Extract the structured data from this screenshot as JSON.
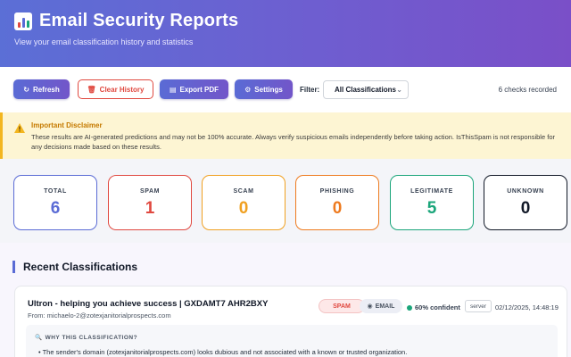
{
  "header": {
    "title": "Email Security Reports",
    "subtitle": "View your email classification history and statistics"
  },
  "toolbar": {
    "refresh_label": "Refresh",
    "clear_label": "Clear History",
    "export_label": "Export PDF",
    "settings_label": "Settings",
    "filter_label": "Filter:",
    "filter_selected": "All Classifications",
    "checks_recorded": "6 checks recorded"
  },
  "disclaimer": {
    "title": "Important Disclaimer",
    "text": "These results are AI-generated predictions and may not be 100% accurate. Always verify suspicious emails independently before taking action. IsThisSpam is not responsible for any decisions made based on these results."
  },
  "stats": [
    {
      "label": "TOTAL",
      "value": "6",
      "color": "#5a6bd5"
    },
    {
      "label": "SPAM",
      "value": "1",
      "color": "#e0483f"
    },
    {
      "label": "SCAM",
      "value": "0",
      "color": "#f0a020"
    },
    {
      "label": "PHISHING",
      "value": "0",
      "color": "#ee7a1e"
    },
    {
      "label": "LEGITIMATE",
      "value": "5",
      "color": "#1aa57a"
    },
    {
      "label": "UNKNOWN",
      "value": "0",
      "color": "#111827"
    }
  ],
  "recent": {
    "title": "Recent Classifications",
    "items": [
      {
        "subject": "Ultron - helping you achieve success | GXDAMT7 AHR2BXY",
        "from": "From: michaelo-2@zotexjanitorialprospects.com",
        "classification": "SPAM",
        "type": "EMAIL",
        "confidence": "60% confident",
        "source": "server",
        "timestamp": "02/12/2025, 14:48:19",
        "why_title": "WHY THIS CLASSIFICATION?",
        "reason": "The sender's domain (zotexjanitorialprospects.com) looks dubious and not associated with a known or trusted organization."
      }
    ]
  },
  "colors": {
    "accent": "#5a6bd5",
    "danger": "#e0483f",
    "warning_bg": "#fdf5d3",
    "success": "#1aa57a"
  },
  "icons": {
    "logo": "bar-chart-icon",
    "refresh": "refresh-icon",
    "clear": "trash-icon",
    "export": "document-icon",
    "settings": "gear-icon",
    "warning": "warning-icon"
  }
}
